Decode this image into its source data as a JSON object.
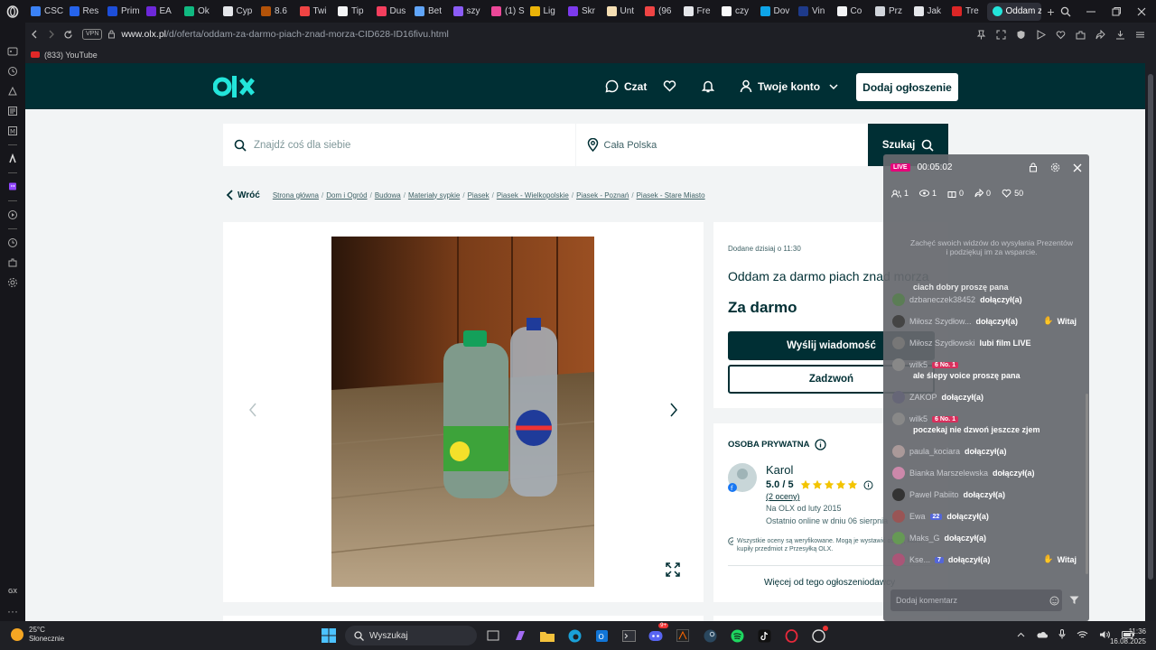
{
  "browser": {
    "tabs": [
      {
        "label": "CSC",
        "color": "#3b82f6"
      },
      {
        "label": "Res",
        "color": "#2563eb"
      },
      {
        "label": "Prim",
        "color": "#1d4ed8"
      },
      {
        "label": "EA",
        "color": "#6d28d9"
      },
      {
        "label": "Ok",
        "color": "#10b981"
      },
      {
        "label": "Cyp",
        "color": "#e5e7eb"
      },
      {
        "label": "8.6",
        "color": "#b45309"
      },
      {
        "label": "Twi",
        "color": "#ef4444"
      },
      {
        "label": "Tip",
        "color": "#f3f4f6"
      },
      {
        "label": "Dus",
        "color": "#f43f5e"
      },
      {
        "label": "Bet",
        "color": "#60a5fa"
      },
      {
        "label": "szy",
        "color": "#8b5cf6"
      },
      {
        "label": "(1) S",
        "color": "#ec4899"
      },
      {
        "label": "Lig",
        "color": "#eab308"
      },
      {
        "label": "Skr",
        "color": "#7c3aed"
      },
      {
        "label": "Unt",
        "color": "#f5deb3"
      },
      {
        "label": "(96",
        "color": "#ef4444"
      },
      {
        "label": "Fre",
        "color": "#e5e7eb"
      },
      {
        "label": "czy",
        "color": "#f9fafb"
      },
      {
        "label": "Dov",
        "color": "#0ea5e9"
      },
      {
        "label": "Vin",
        "color": "#1e3a8a"
      },
      {
        "label": "Co",
        "color": "#f3f4f6"
      },
      {
        "label": "Prz",
        "color": "#d1d5db"
      },
      {
        "label": "Jak",
        "color": "#e5e7eb"
      },
      {
        "label": "Tre",
        "color": "#dc2626"
      }
    ],
    "active_tab": {
      "label": "Oddam z",
      "color": "#23e5db"
    },
    "vpn_label": "VPN",
    "url_domain": "www.olx.pl",
    "url_path": "/d/oferta/oddam-za-darmo-piach-znad-morza-CID628-ID16fivu.html",
    "bookmark": "(833) YouTube"
  },
  "olx": {
    "nav": {
      "chat": "Czat",
      "account": "Twoje konto",
      "add_ad": "Dodaj ogłoszenie"
    },
    "search": {
      "placeholder": "Znajdź coś dla siebie",
      "location": "Cała Polska",
      "button": "Szukaj"
    },
    "back": "Wróć",
    "breadcrumbs": [
      "Strona główna",
      "Dom i Ogród",
      "Budowa",
      "Materiały sypkie",
      "Piasek",
      "Piasek - Wielkopolskie",
      "Piasek - Poznań",
      "Piasek - Stare Miasto"
    ],
    "ad": {
      "posted": "Dodane dzisiaj o 11:30",
      "title": "Oddam za darmo piach znad morza",
      "price": "Za darmo",
      "message_button": "Wyślij wiadomość",
      "call_button": "Zadzwoń"
    },
    "seller": {
      "type": "OSOBA PRYWATNA",
      "name": "Karol",
      "rating": "5.0 / 5",
      "stars": 5,
      "ratings_count": "(2 oceny)",
      "since": "Na OLX od luty 2015",
      "online": "Ostatnio online w dniu 06 sierpnia",
      "verify_note": "Wszystkie oceny są weryfikowane. Mogą je wystawić osoby, które kupiły przedmiot z Przesyłką OLX.",
      "more_ads": "Więcej od tego ogłoszeniodawcy"
    }
  },
  "live": {
    "badge": "LIVE",
    "time": "00:05:02",
    "stats": {
      "users": "1",
      "views": "1",
      "gifts": "0",
      "shares": "0",
      "likes": "50"
    },
    "hint": "Zachęć swoich widzów do wysyłania Prezentów i podziękuj im za wsparcie.",
    "partial_line": "ciach dobry proszę pana",
    "messages": [
      {
        "user": "dzbaneczek38452",
        "text": "dołączył(a)",
        "avatar": "#5b7d55"
      },
      {
        "user": "Miłosz Szydłow...",
        "text": "dołączył(a)",
        "avatar": "#444",
        "hello": "Witaj"
      },
      {
        "user": "Miłosz Szydłowski",
        "text": "lubi film LIVE",
        "avatar": "#777"
      },
      {
        "user": "wilk5",
        "badge": "6 No. 1",
        "line2": "ale ślepy voice proszę pana",
        "avatar": "#888"
      },
      {
        "user": "ZAKOP",
        "text": "dołączył(a)",
        "avatar": "#667"
      },
      {
        "user": "wilk5",
        "badge": "6 No. 1",
        "line2": "poczekaj nie dzwoń jeszcze zjem",
        "avatar": "#888"
      },
      {
        "user": "paula_kociara",
        "text": "dołączył(a)",
        "avatar": "#a99"
      },
      {
        "user": "Bianka Marszelewska",
        "text": "dołączył(a)",
        "avatar": "#c8a"
      },
      {
        "user": "Pawel Pabiito",
        "text": "dołączył(a)",
        "avatar": "#333"
      },
      {
        "user": "Ewa",
        "badge2": "22",
        "text": "dołączył(a)",
        "avatar": "#955"
      },
      {
        "user": "Maks_G",
        "text": "dołączył(a)",
        "avatar": "#695"
      },
      {
        "user": "Kse...",
        "badge2": "7",
        "text": "dołączył(a)",
        "avatar": "#a57",
        "hello": "Witaj"
      }
    ],
    "comment_placeholder": "Dodaj komentarz"
  },
  "taskbar": {
    "temp": "25°C",
    "weather": "Słonecznie",
    "search": "Wyszukaj",
    "time": "11:36",
    "date": "16.08.2025",
    "discord_badge": "9+"
  },
  "sidebar_label": "GX"
}
